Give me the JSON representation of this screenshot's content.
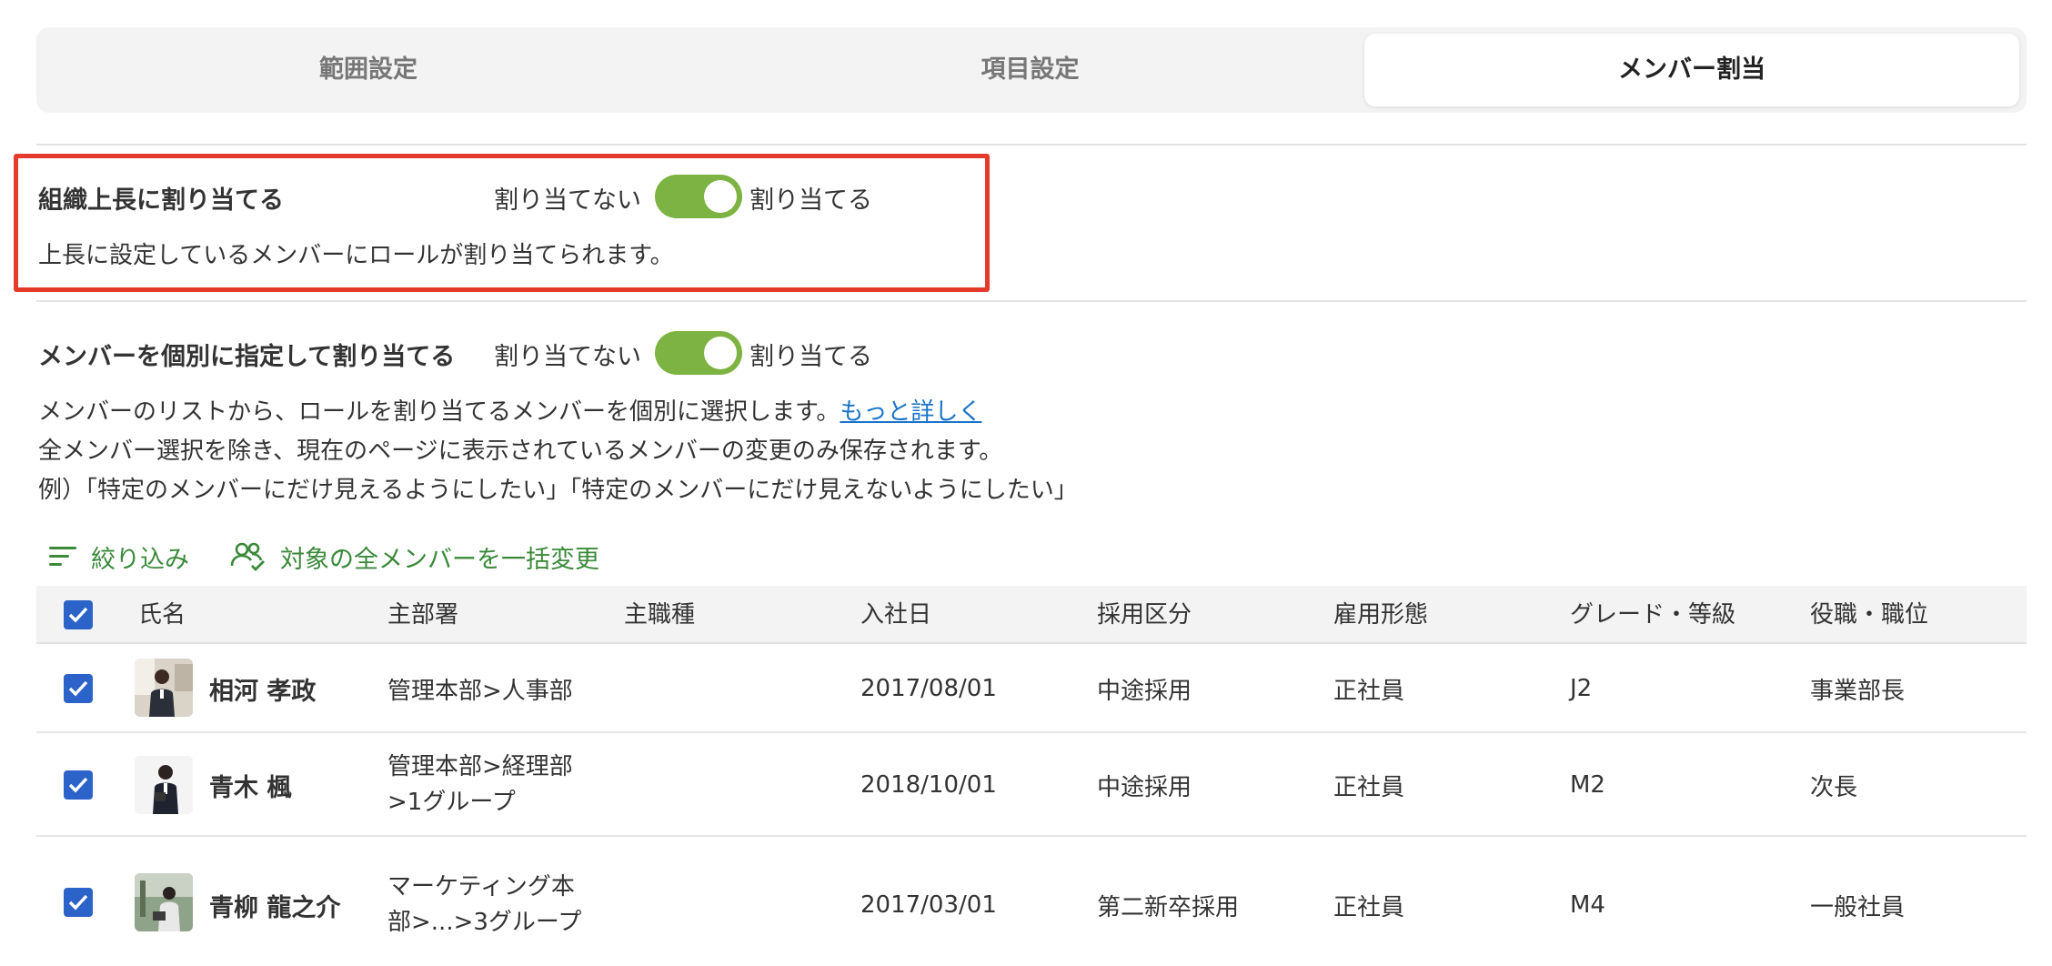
{
  "tabs": [
    {
      "label": "範囲設定",
      "active": false
    },
    {
      "label": "項目設定",
      "active": false
    },
    {
      "label": "メンバー割当",
      "active": true
    }
  ],
  "supervisor_setting": {
    "title": "組織上長に割り当てる",
    "off_label": "割り当てない",
    "on_label": "割り当てる",
    "enabled": true,
    "description": "上長に設定しているメンバーにロールが割り当てられます。"
  },
  "individual_setting": {
    "title": "メンバーを個別に指定して割り当てる",
    "off_label": "割り当てない",
    "on_label": "割り当てる",
    "enabled": true,
    "description_line1": "メンバーのリストから、ロールを割り当てるメンバーを個別に選択します。",
    "more_link": "もっと詳しく",
    "description_line2": "全メンバー選択を除き、現在のページに表示されているメンバーの変更のみ保存されます。",
    "description_line3": "例）「特定のメンバーにだけ見えるようにしたい」「特定のメンバーにだけ見えないようにしたい」"
  },
  "actions": {
    "filter_label": "絞り込み",
    "bulk_change_label": "対象の全メンバーを一括変更"
  },
  "table": {
    "columns": [
      "氏名",
      "主部署",
      "主職種",
      "入社日",
      "採用区分",
      "雇用形態",
      "グレード・等級",
      "役職・職位"
    ],
    "rows": [
      {
        "checked": true,
        "name": "相河 孝政",
        "department": "管理本部>人事部",
        "job_type": "",
        "hire_date": "2017/08/01",
        "hiring_category": "中途採用",
        "employment_type": "正社員",
        "grade": "J2",
        "position": "事業部長"
      },
      {
        "checked": true,
        "name": "青木 楓",
        "department": "管理本部>経理部>1グループ",
        "job_type": "",
        "hire_date": "2018/10/01",
        "hiring_category": "中途採用",
        "employment_type": "正社員",
        "grade": "M2",
        "position": "次長"
      },
      {
        "checked": true,
        "name": "青柳 龍之介",
        "department": "マーケティング本部>...>3グループ",
        "job_type": "",
        "hire_date": "2017/03/01",
        "hiring_category": "第二新卒採用",
        "employment_type": "正社員",
        "grade": "M4",
        "position": "一般社員"
      }
    ]
  },
  "colors": {
    "toggle_on": "#7cb342",
    "highlight_border": "#e53b2c",
    "action_green": "#3a8a3a",
    "checkbox_blue": "#2c63c8",
    "link_blue": "#1a73c8"
  },
  "icons": [
    "filter-lines-icon",
    "users-check-icon",
    "checkmark-icon",
    "avatar-photo-icon"
  ]
}
